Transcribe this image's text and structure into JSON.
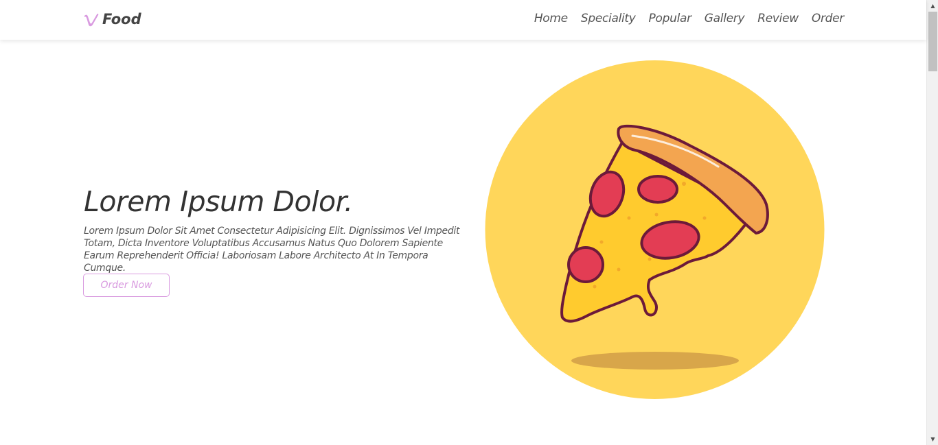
{
  "header": {
    "logo_text": "Food",
    "nav": [
      {
        "label": "Home"
      },
      {
        "label": "Speciality"
      },
      {
        "label": "Popular"
      },
      {
        "label": "Gallery"
      },
      {
        "label": "Review"
      },
      {
        "label": "Order"
      }
    ]
  },
  "hero": {
    "title": "Lorem Ipsum Dolor.",
    "description": "Lorem Ipsum Dolor Sit Amet Consectetur Adipisicing Elit. Dignissimos Vel Impedit Totam, Dicta Inventore Voluptatibus Accusamus Natus Quo Dolorem Sapiente Earum Reprehenderit Officia! Laboriosam Labore Architecto At In Tempora Cumque.",
    "button_label": "Order Now",
    "image_icon": "pizza-slice-icon"
  },
  "colors": {
    "accent": "#d99be0",
    "circle": "#ffd65a",
    "crust": "#f3a550",
    "cheese": "#ffcb2e",
    "pepperoni": "#e33d54",
    "outline": "#6c1a3a",
    "shadow": "#d8a64a"
  },
  "scrollbar": {
    "up_glyph": "▲",
    "down_glyph": "▼"
  }
}
